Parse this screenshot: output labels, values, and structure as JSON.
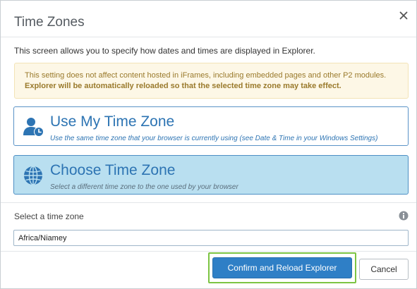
{
  "dialog": {
    "title": "Time Zones",
    "description": "This screen allows you to specify how dates and times are displayed in Explorer.",
    "warning": {
      "line1": "This setting does not affect content hosted in iFrames, including embedded pages and other P2 modules.",
      "line2": "Explorer will be automatically reloaded so that the selected time zone may take effect."
    },
    "options": [
      {
        "icon": "user-clock-icon",
        "heading": "Use My Time Zone",
        "sub": "Use the same time zone that your browser is currently using (see Date & Time in your Windows Settings)",
        "selected": false
      },
      {
        "icon": "globe-icon",
        "heading": "Choose Time Zone",
        "sub": "Select a different time zone to the one used by your browser",
        "selected": true
      }
    ],
    "timezone_field": {
      "label": "Select a time zone",
      "value": "Africa/Niamey"
    },
    "buttons": {
      "confirm": "Confirm and Reload Explorer",
      "cancel": "Cancel"
    }
  },
  "colors": {
    "accent": "#2d74b3",
    "primary_button": "#2f7fc6",
    "selected_bg": "#b9dff0",
    "warning_bg": "#fdf7e6",
    "warning_text": "#9a7a2c",
    "highlight": "#7cc443"
  }
}
